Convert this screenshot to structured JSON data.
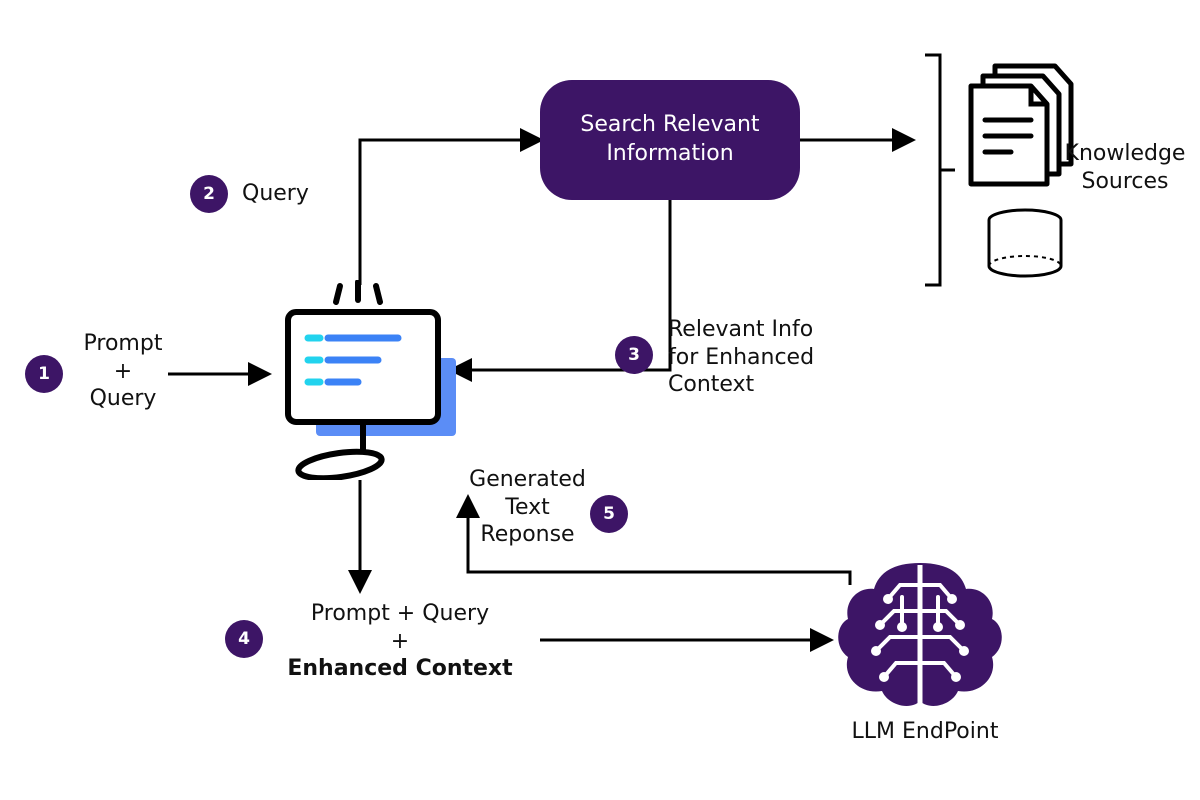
{
  "diagram": {
    "steps": {
      "s1": {
        "num": "1",
        "label_line1": "Prompt",
        "label_line2": "+",
        "label_line3": "Query"
      },
      "s2": {
        "num": "2",
        "label": "Query"
      },
      "s3": {
        "num": "3",
        "label_line1": "Relevant Info",
        "label_line2": "for Enhanced",
        "label_line3": "Context"
      },
      "s4": {
        "num": "4",
        "label_line1": "Prompt + Query",
        "label_line2": "+",
        "label_bold": "Enhanced Context"
      },
      "s5": {
        "num": "5",
        "label_line1": "Generated",
        "label_line2": "Text",
        "label_line3": "Reponse"
      }
    },
    "nodes": {
      "search_box": "Search Relevant Information",
      "knowledge_sources": "Knowledge Sources",
      "llm_endpoint": "LLM EndPoint"
    },
    "colors": {
      "purple": "#3d1566",
      "accent_blue": "#3b82f6",
      "accent_teal": "#22d3ee"
    }
  }
}
